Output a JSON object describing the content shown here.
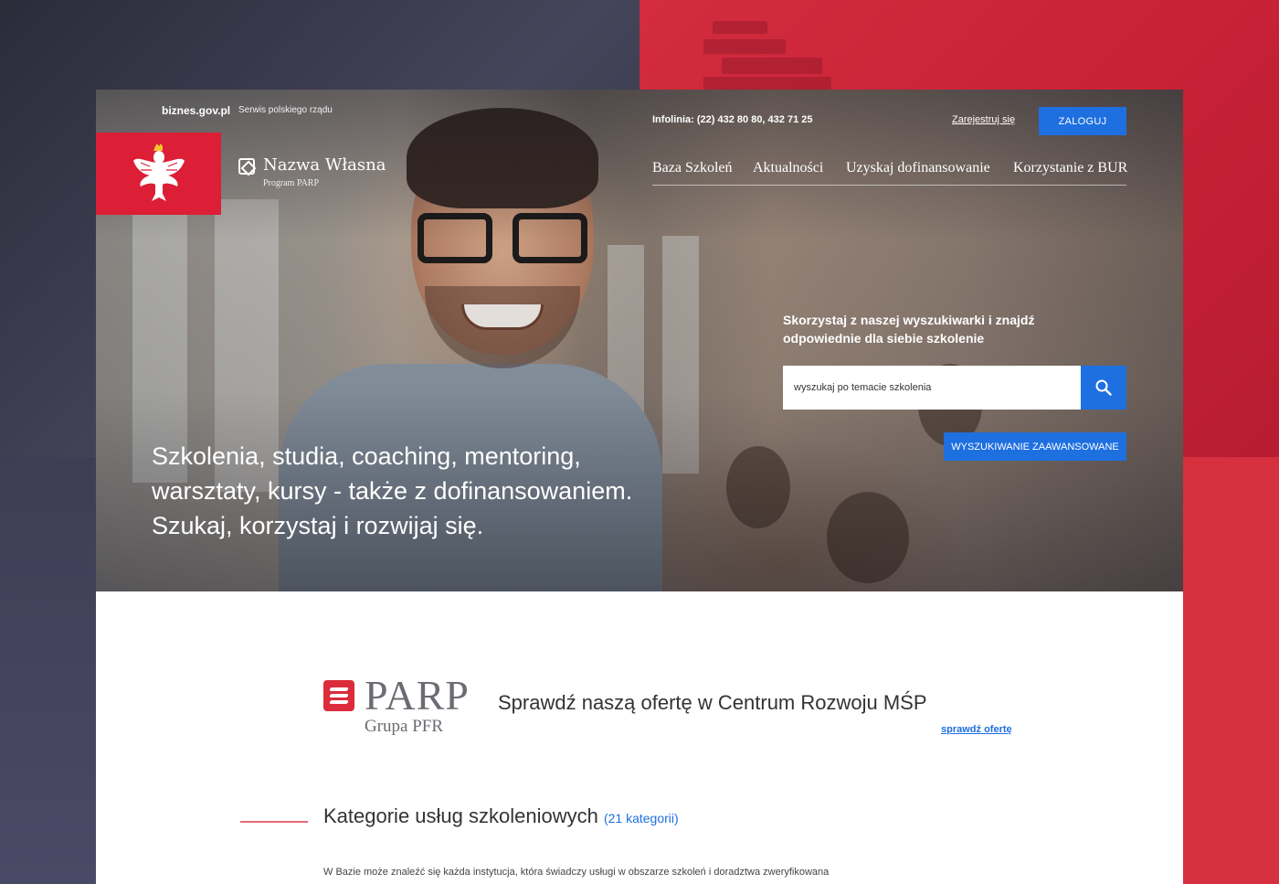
{
  "topbar": {
    "gov_link": "biznes.gov.pl",
    "gov_desc": "Serwis polskiego rządu",
    "infoline": "Infolinia: (22) 432 80 80, 432 71 25",
    "register": "Zarejestruj się",
    "login": "ZALOGUJ"
  },
  "brand": {
    "name": "Nazwa Własna",
    "sub": "Program PARP"
  },
  "nav": {
    "items": [
      "Baza Szkoleń",
      "Aktualności",
      "Uzyskaj dofinansowanie",
      "Korzystanie z BUR"
    ]
  },
  "hero": {
    "claim_line1": "Szkolenia, studia, coaching, mentoring,",
    "claim_line2": "warsztaty, kursy - także z dofinansowaniem.",
    "claim_line3": "Szukaj, korzystaj i rozwijaj się."
  },
  "search": {
    "intro": "Skorzystaj z naszej wyszukiwarki i znajdź odpowiednie dla siebie szkolenie",
    "placeholder": "wyszukaj po temacie szkolenia",
    "advanced": "WYSZUKIWANIE ZAAWANSOWANE"
  },
  "parp": {
    "logo_word": "PARP",
    "logo_sub": "Grupa PFR",
    "offer": "Sprawdź naszą ofertę w Centrum Rozwoju MŚP",
    "offer_link": "sprawdź ofertę"
  },
  "categories": {
    "title": "Kategorie usług szkoleniowych",
    "count": "(21 kategorii)",
    "desc": "W Bazie może znaleźć się każda instytucja, która świadczy usługi w obszarze szkoleń i doradztwa zweryfikowana"
  },
  "colors": {
    "accent_blue": "#1e6fe0",
    "gov_red": "#dc1e36",
    "parp_red": "#dc2b3a"
  },
  "icons": {
    "search": "search-icon",
    "eagle": "white-eagle-emblem-icon",
    "brand": "diamond-logo-icon"
  }
}
